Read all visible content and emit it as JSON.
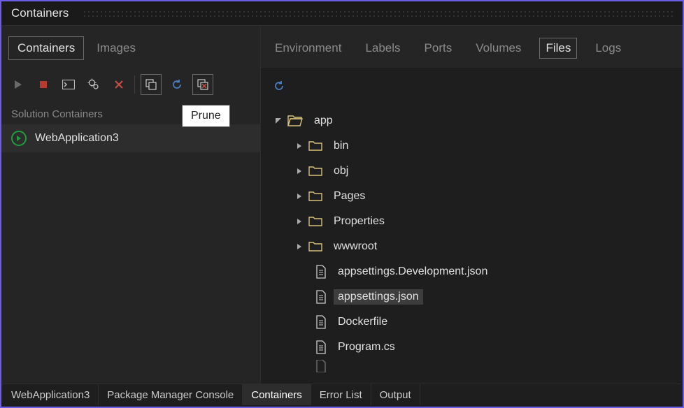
{
  "window": {
    "title": "Containers"
  },
  "sidebar": {
    "tabs": {
      "containers": "Containers",
      "images": "Images"
    },
    "section_label": "Solution Containers",
    "items": [
      {
        "name": "WebApplication3"
      }
    ]
  },
  "tooltip": "Prune",
  "content": {
    "tabs": {
      "environment": "Environment",
      "labels": "Labels",
      "ports": "Ports",
      "volumes": "Volumes",
      "files": "Files",
      "logs": "Logs"
    },
    "tree": {
      "root": "app",
      "folders": [
        "bin",
        "obj",
        "Pages",
        "Properties",
        "wwwroot"
      ],
      "files": [
        "appsettings.Development.json",
        "appsettings.json",
        "Dockerfile",
        "Program.cs"
      ],
      "selected": "appsettings.json"
    }
  },
  "bottom_tabs": {
    "t0": "WebApplication3",
    "t1": "Package Manager Console",
    "t2": "Containers",
    "t3": "Error List",
    "t4": "Output"
  }
}
